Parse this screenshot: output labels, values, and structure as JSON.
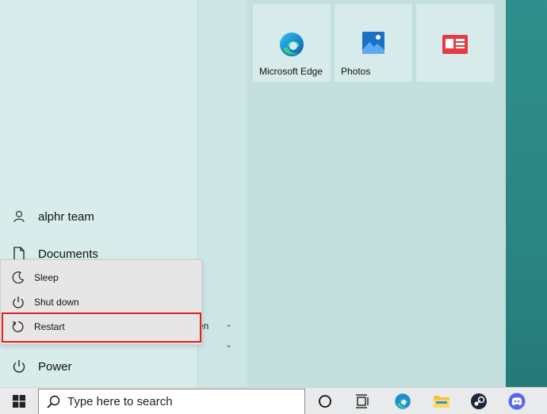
{
  "tiles": [
    {
      "label": "Microsoft Edge",
      "icon": "edge-icon"
    },
    {
      "label": "Photos",
      "icon": "photos-icon"
    },
    {
      "label": "",
      "icon": "news-icon"
    }
  ],
  "rail": {
    "user": {
      "label": "alphr team",
      "icon": "user-icon"
    },
    "documents": {
      "label": "Documents",
      "icon": "document-icon"
    },
    "power": {
      "label": "Power",
      "icon": "power-icon"
    }
  },
  "power_menu": {
    "items": [
      {
        "label": "Sleep",
        "icon": "moon-icon"
      },
      {
        "label": "Shut down",
        "icon": "power-icon"
      },
      {
        "label": "Restart",
        "icon": "restart-icon"
      }
    ]
  },
  "app_list": {
    "partial_text": "en"
  },
  "taskbar": {
    "search_placeholder": "Type here to search",
    "icons": [
      "windows-start-icon",
      "cortana-icon",
      "task-view-icon",
      "edge-icon",
      "file-explorer-icon",
      "steam-icon",
      "discord-icon"
    ]
  },
  "colors": {
    "highlight": "#e0201f",
    "accent": "#0078d4",
    "discord": "#5865f2"
  }
}
